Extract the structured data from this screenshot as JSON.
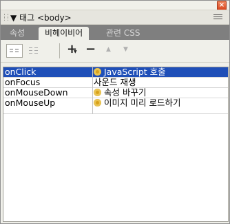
{
  "panel": {
    "close_glyph": "×",
    "title": "▼ 태그 <body>"
  },
  "tabs": [
    {
      "label": "속성",
      "active": false
    },
    {
      "label": "비헤이비어",
      "active": true
    },
    {
      "label": "관련 CSS",
      "active": false
    }
  ],
  "toolbar": {
    "add_glyph": "+",
    "remove_glyph": "−",
    "up_glyph": "▲",
    "down_glyph": "▼"
  },
  "behaviors": [
    {
      "event": "onClick",
      "action": "JavaScript 호출",
      "icon": "gear-icon",
      "selected": true
    },
    {
      "event": "onFocus",
      "action": "사운드 재생",
      "icon": null,
      "selected": false
    },
    {
      "event": "onMouseDown",
      "action": "속성 바꾸기",
      "icon": "gear-icon",
      "selected": false
    },
    {
      "event": "onMouseUp",
      "action": "이미지 미리 로드하기",
      "icon": "gear-icon",
      "selected": false
    }
  ],
  "colors": {
    "selection": "#1f4fb8",
    "tabbar": "#7f7f7f"
  }
}
